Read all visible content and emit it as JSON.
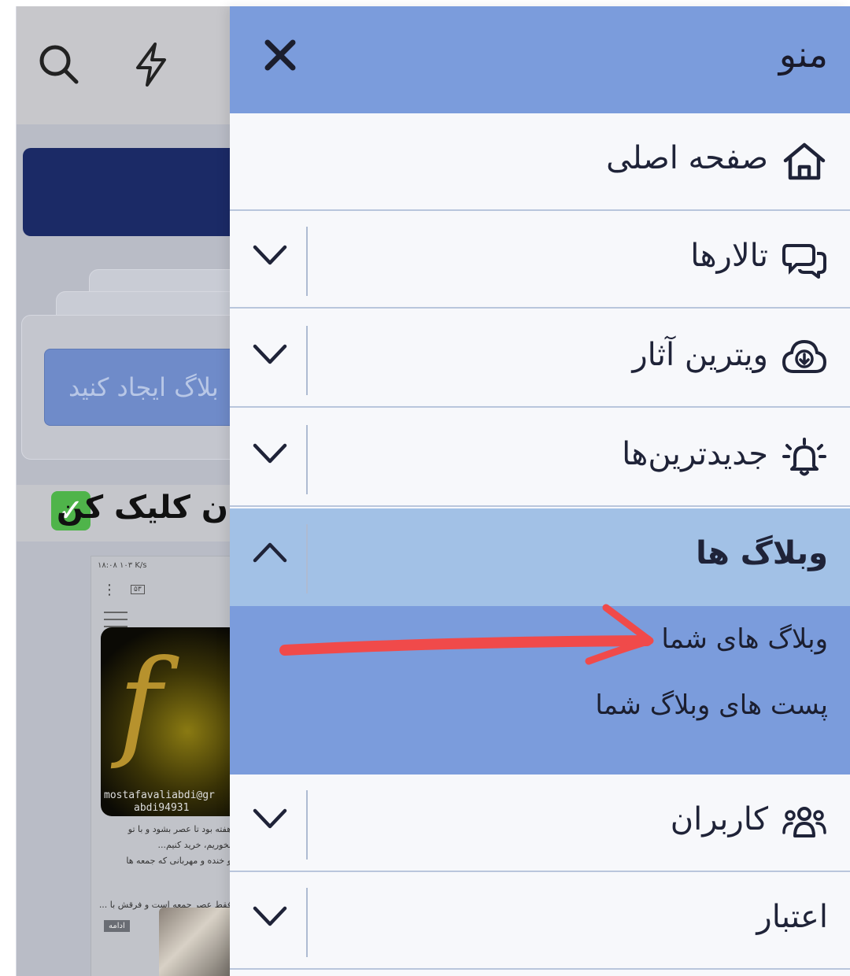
{
  "background": {
    "create_button_text": "بلاگ ایجاد کنید",
    "click_text": "ن کلیک کن",
    "check_icon": "check-mark-icon",
    "email_line_1": "mostafavaliabdi@gr",
    "email_line_2": "abdi94931",
    "mini_status": "۱۸:۰۸ ۱۰۳ K/s",
    "mini_text_1": "هفته بود تا عصر بشود و با تو",
    "mini_text_2": "بخوریم، خرید کنیم...",
    "mini_text_3": "و خنده و مهربانی که جمعه ها",
    "mini_text_4": "فقط عصر جمعه است و فرقش با ...",
    "mini_more_label": "ادامه",
    "mini_badge": "۵۳"
  },
  "drawer": {
    "title": "منو",
    "close_icon": "close-icon",
    "items": [
      {
        "label": "صفحه اصلی",
        "icon": "home-icon"
      },
      {
        "label": "تالارها",
        "icon": "chat-bubbles-icon"
      },
      {
        "label": "ویترین آثار",
        "icon": "cloud-download-icon"
      },
      {
        "label": "جدیدترین‌ها",
        "icon": "bell-ringing-icon"
      },
      {
        "label": "وبلاگ ها",
        "expanded": true,
        "subitems": [
          "وبلاگ های شما",
          "پست های وبلاگ شما"
        ]
      },
      {
        "label": "کاربران",
        "icon": "users-icon"
      },
      {
        "label": "اعتبار"
      }
    ]
  },
  "colors": {
    "header": "#7b9cdc",
    "expanded_row": "#a2c1e6",
    "submenu": "#7b9cdc",
    "annotation_arrow": "#f04a4a"
  }
}
